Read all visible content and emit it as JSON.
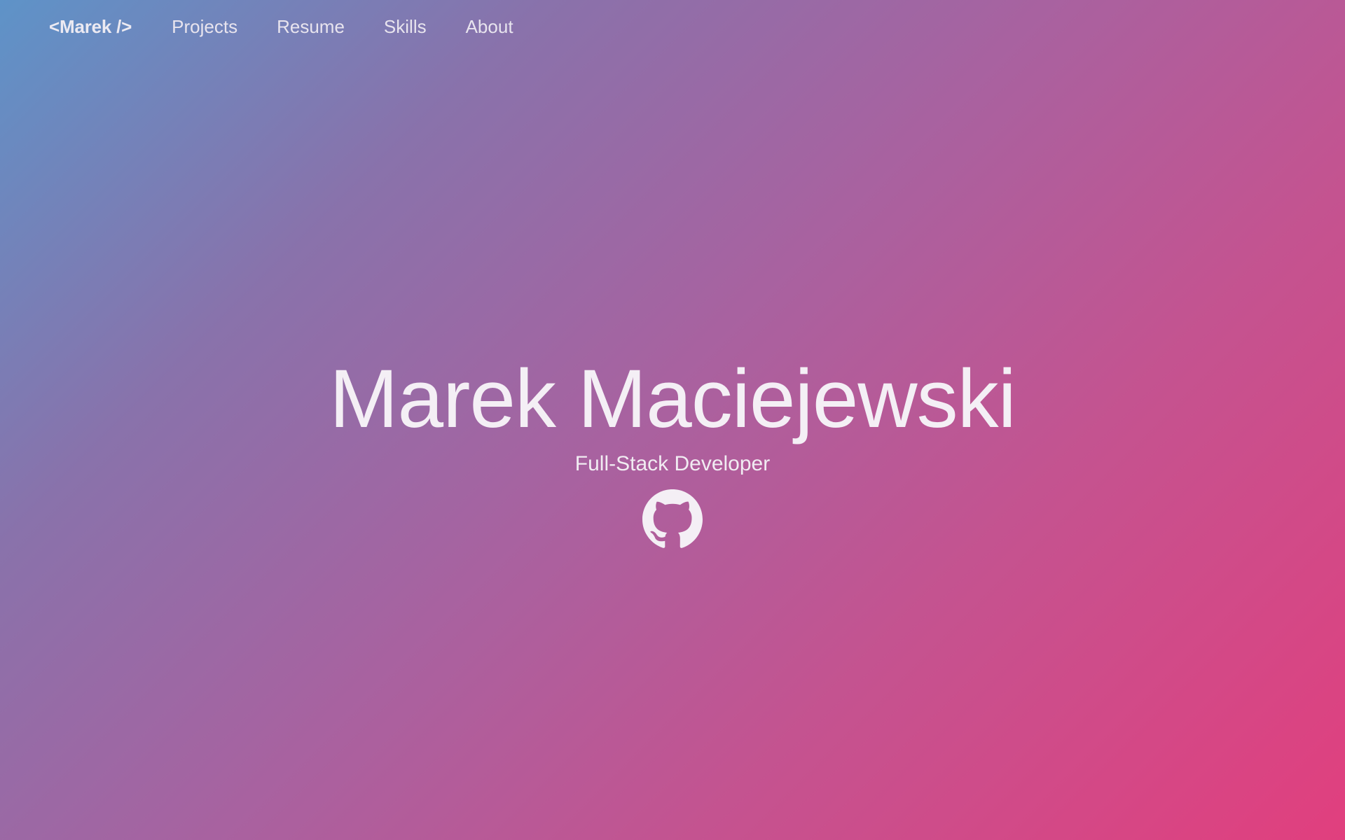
{
  "nav": {
    "brand": "<Marek />",
    "items": [
      {
        "label": "Projects"
      },
      {
        "label": "Resume"
      },
      {
        "label": "Skills"
      },
      {
        "label": "About"
      }
    ]
  },
  "hero": {
    "name": "Marek Maciejewski",
    "subtitle": "Full-Stack Developer",
    "social_icon": "github-icon"
  },
  "colors": {
    "gradient_start": "#5e93c8",
    "gradient_mid": "#a862a0",
    "gradient_end": "#e13f7e",
    "text": "#f2eef3"
  }
}
